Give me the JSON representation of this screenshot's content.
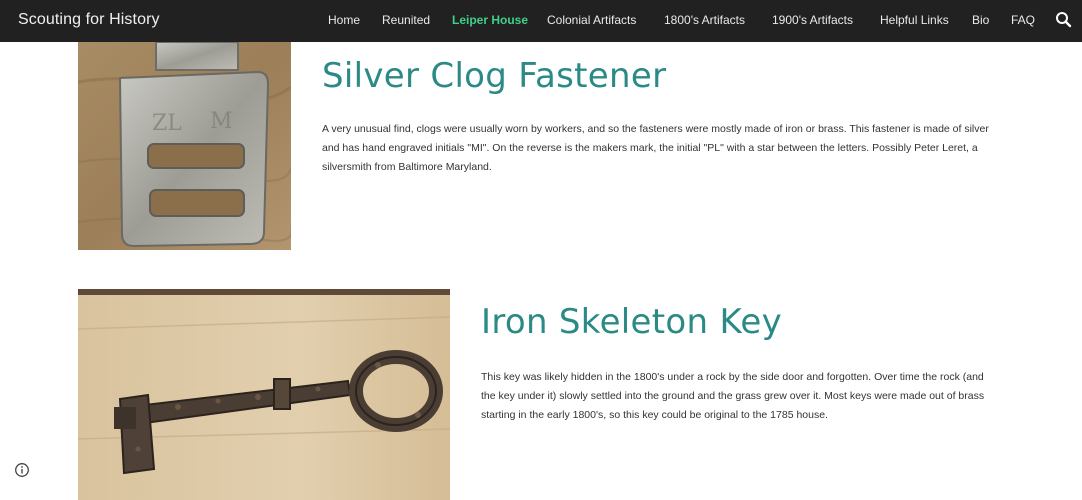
{
  "header": {
    "site_title": "Scouting for History",
    "nav": [
      {
        "label": "Home",
        "active": false
      },
      {
        "label": "Reunited",
        "active": false
      },
      {
        "label": "Leiper House",
        "active": true
      },
      {
        "label": "Colonial Artifacts",
        "active": false
      },
      {
        "label": "1800's Artifacts",
        "active": false
      },
      {
        "label": "1900's Artifacts",
        "active": false
      },
      {
        "label": "Helpful Links",
        "active": false
      },
      {
        "label": "Bio",
        "active": false
      },
      {
        "label": "FAQ",
        "active": false
      }
    ],
    "search_icon": "search-icon"
  },
  "artifacts": [
    {
      "title": "Silver Clog Fastener",
      "description": "A very unusual find, clogs were usually worn by workers, and so the fasteners were mostly made of iron or brass. This fastener is made of silver and has hand engraved initials \"MI\". On the reverse is the makers mark, the initial \"PL\" with a star between the letters. Possibly Peter Leret, a silversmith from Baltimore Maryland.",
      "image": "silver-clog-fastener-photo"
    },
    {
      "title": "Iron Skeleton Key",
      "description": "This key was likely hidden in the 1800's under a rock by the side door and forgotten. Over time the rock (and the key under it) slowly settled into the ground and the grass grew over it.  Most keys were made out of brass starting in the early 1800's, so this key could be original to the 1785 house.",
      "image": "iron-skeleton-key-photo"
    }
  ],
  "footer": {
    "info_icon": "info-icon"
  },
  "colors": {
    "nav_background": "#212121",
    "nav_active": "#3fd08a",
    "heading": "#2b8a86"
  }
}
